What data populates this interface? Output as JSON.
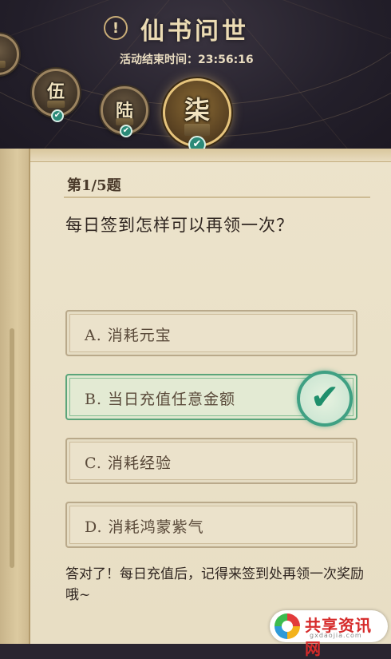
{
  "header": {
    "info_icon": "!",
    "title": "仙书问世",
    "timer_label": "活动结束时间：",
    "timer_value": "23:56:16"
  },
  "chapters": [
    {
      "label": "",
      "completed": false,
      "state": "partial"
    },
    {
      "label": "伍",
      "completed": true,
      "state": "done"
    },
    {
      "label": "陆",
      "completed": true,
      "state": "done"
    },
    {
      "label": "柒",
      "completed": true,
      "state": "current"
    }
  ],
  "quiz": {
    "number": "第1/5题",
    "question": "每日签到怎样可以再领一次？",
    "options": [
      {
        "text": "A. 消耗元宝",
        "state": "normal"
      },
      {
        "text": "B. 当日充值任意金额",
        "state": "correct"
      },
      {
        "text": "C. 消耗经验",
        "state": "normal"
      },
      {
        "text": "D. 消耗鸿蒙紫气",
        "state": "normal"
      }
    ],
    "feedback": "答对了！每日充值后，记得来签到处再领一次奖励哦~"
  },
  "watermark": {
    "name": "共享资讯网",
    "url": "gxdaojia.com"
  },
  "colors": {
    "correct_accent": "#3fa083",
    "panel_bg": "#ece3cb",
    "header_bg": "#231f2a"
  },
  "icons": {
    "check": "✔"
  }
}
